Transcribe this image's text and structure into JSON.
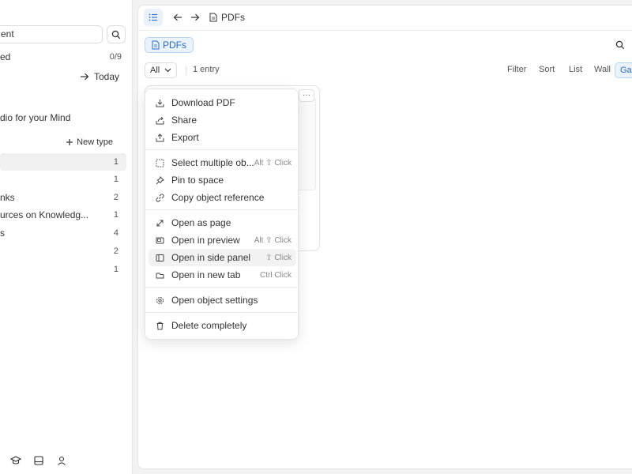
{
  "sidebar": {
    "search_value": "ent",
    "widget_label": "ed",
    "widget_count": "0/9",
    "today_label": "Today",
    "space_title": "dio for your Mind",
    "new_type_label": "New type",
    "types": [
      {
        "label": "",
        "count": "1",
        "active": true
      },
      {
        "label": "",
        "count": "1"
      },
      {
        "label": "nks",
        "count": "2"
      },
      {
        "label": "urces on Knowledg...",
        "count": "1"
      },
      {
        "label": "s",
        "count": "4"
      },
      {
        "label": "",
        "count": "2"
      },
      {
        "label": "",
        "count": "1"
      }
    ]
  },
  "main": {
    "breadcrumb": "PDFs",
    "chip_label": "PDFs",
    "filter_all": "All",
    "entries": "1 entry",
    "views": {
      "filter": "Filter",
      "sort": "Sort",
      "list": "List",
      "wall": "Wall",
      "gallery": "Gal"
    },
    "card_more": "···"
  },
  "menu": {
    "groups": [
      [
        {
          "label": "Download PDF",
          "icon": "download-icon"
        },
        {
          "label": "Share",
          "icon": "share-icon"
        },
        {
          "label": "Export",
          "icon": "export-icon"
        }
      ],
      [
        {
          "label": "Select multiple ob...",
          "shortcut": "Alt ⇧ Click",
          "icon": "select-icon"
        },
        {
          "label": "Pin to space",
          "icon": "pin-icon"
        },
        {
          "label": "Copy object reference",
          "icon": "link-icon"
        }
      ],
      [
        {
          "label": "Open as page",
          "icon": "expand-icon"
        },
        {
          "label": "Open in preview",
          "shortcut": "Alt ⇧ Click",
          "icon": "preview-icon"
        },
        {
          "label": "Open in side panel",
          "shortcut": "⇧ Click",
          "icon": "side-panel-icon",
          "highlighted": true
        },
        {
          "label": "Open in new tab",
          "shortcut": "Ctrl Click",
          "icon": "new-tab-icon"
        }
      ],
      [
        {
          "label": "Open object settings",
          "icon": "settings-icon"
        }
      ],
      [
        {
          "label": "Delete completely",
          "icon": "trash-icon"
        }
      ]
    ]
  }
}
